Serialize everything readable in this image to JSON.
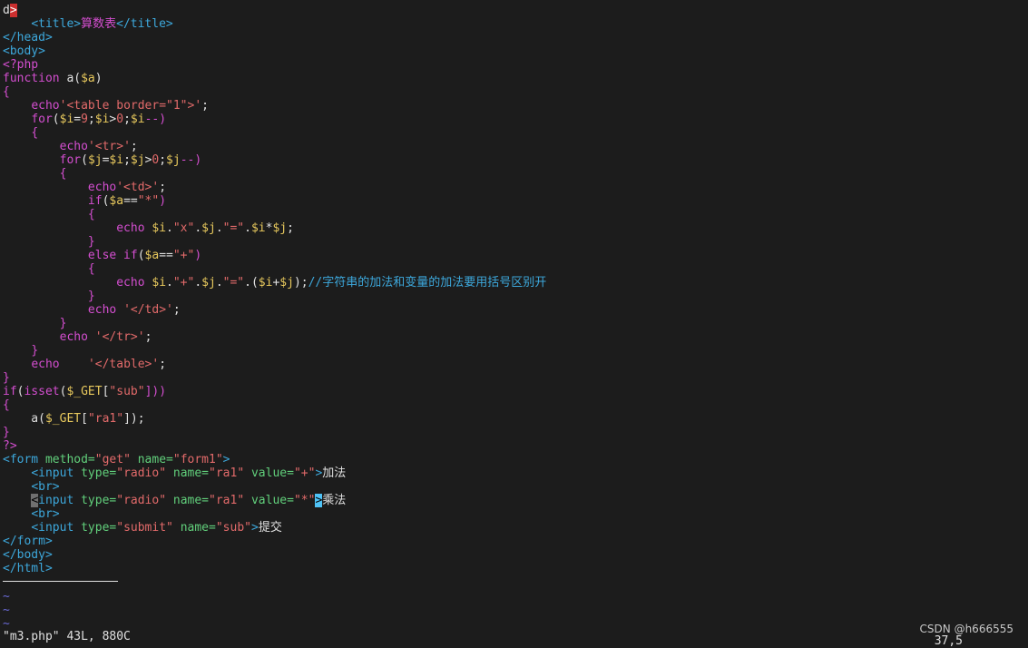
{
  "colors": {
    "background": "#1c1c1c",
    "text": "#e0e0e0",
    "keyword": "#d34ecf",
    "variable": "#e8c95d",
    "string": "#e26a6a",
    "tag": "#3da8dc",
    "attr": "#61cf7b",
    "comment": "#3da8dc",
    "tilde": "#6a6ad6"
  },
  "lines": [
    [
      {
        "t": "d",
        "c": "#e0e0e0"
      },
      {
        "t": ">",
        "c": "#ffffff",
        "cls": "cur"
      }
    ],
    [
      {
        "t": "    ",
        "c": "#e0e0e0"
      },
      {
        "t": "<title>",
        "c": "#3da8dc"
      },
      {
        "t": "算数表",
        "c": "#d34ecf"
      },
      {
        "t": "</title>",
        "c": "#3da8dc"
      }
    ],
    [
      {
        "t": "</head>",
        "c": "#3da8dc"
      }
    ],
    [
      {
        "t": "<body>",
        "c": "#3da8dc"
      }
    ],
    [
      {
        "t": "<?php",
        "c": "#d34ecf"
      }
    ],
    [
      {
        "t": "function",
        "c": "#d34ecf"
      },
      {
        "t": " a(",
        "c": "#e0e0e0"
      },
      {
        "t": "$a",
        "c": "#e8c95d"
      },
      {
        "t": ")",
        "c": "#e0e0e0"
      }
    ],
    [
      {
        "t": "{",
        "c": "#d34ecf"
      }
    ],
    [
      {
        "t": "    ",
        "c": "#e0e0e0"
      },
      {
        "t": "echo",
        "c": "#d34ecf"
      },
      {
        "t": "'<table border=\"1\">'",
        "c": "#e26a6a"
      },
      {
        "t": ";",
        "c": "#e0e0e0"
      }
    ],
    [
      {
        "t": "    ",
        "c": "#e0e0e0"
      },
      {
        "t": "for",
        "c": "#d34ecf"
      },
      {
        "t": "(",
        "c": "#e0e0e0"
      },
      {
        "t": "$i",
        "c": "#e8c95d"
      },
      {
        "t": "=",
        "c": "#e0e0e0"
      },
      {
        "t": "9",
        "c": "#e26a6a"
      },
      {
        "t": ";",
        "c": "#e0e0e0"
      },
      {
        "t": "$i",
        "c": "#e8c95d"
      },
      {
        "t": ">",
        "c": "#e0e0e0"
      },
      {
        "t": "0",
        "c": "#e26a6a"
      },
      {
        "t": ";",
        "c": "#e0e0e0"
      },
      {
        "t": "$i",
        "c": "#e8c95d"
      },
      {
        "t": "--)",
        "c": "#d34ecf"
      }
    ],
    [
      {
        "t": "    ",
        "c": "#e0e0e0"
      },
      {
        "t": "{",
        "c": "#d34ecf"
      }
    ],
    [
      {
        "t": "        ",
        "c": "#e0e0e0"
      },
      {
        "t": "echo",
        "c": "#d34ecf"
      },
      {
        "t": "'<tr>'",
        "c": "#e26a6a"
      },
      {
        "t": ";",
        "c": "#e0e0e0"
      }
    ],
    [
      {
        "t": "        ",
        "c": "#e0e0e0"
      },
      {
        "t": "for",
        "c": "#d34ecf"
      },
      {
        "t": "(",
        "c": "#e0e0e0"
      },
      {
        "t": "$j",
        "c": "#e8c95d"
      },
      {
        "t": "=",
        "c": "#e0e0e0"
      },
      {
        "t": "$i",
        "c": "#e8c95d"
      },
      {
        "t": ";",
        "c": "#e0e0e0"
      },
      {
        "t": "$j",
        "c": "#e8c95d"
      },
      {
        "t": ">",
        "c": "#e0e0e0"
      },
      {
        "t": "0",
        "c": "#e26a6a"
      },
      {
        "t": ";",
        "c": "#e0e0e0"
      },
      {
        "t": "$j",
        "c": "#e8c95d"
      },
      {
        "t": "--)",
        "c": "#d34ecf"
      }
    ],
    [
      {
        "t": "        ",
        "c": "#e0e0e0"
      },
      {
        "t": "{",
        "c": "#d34ecf"
      }
    ],
    [
      {
        "t": "            ",
        "c": "#e0e0e0"
      },
      {
        "t": "echo",
        "c": "#d34ecf"
      },
      {
        "t": "'<td>'",
        "c": "#e26a6a"
      },
      {
        "t": ";",
        "c": "#e0e0e0"
      }
    ],
    [
      {
        "t": "            ",
        "c": "#e0e0e0"
      },
      {
        "t": "if",
        "c": "#d34ecf"
      },
      {
        "t": "(",
        "c": "#e0e0e0"
      },
      {
        "t": "$a",
        "c": "#e8c95d"
      },
      {
        "t": "==",
        "c": "#e0e0e0"
      },
      {
        "t": "\"*\"",
        "c": "#e26a6a"
      },
      {
        "t": ")",
        "c": "#d34ecf"
      }
    ],
    [
      {
        "t": "            ",
        "c": "#e0e0e0"
      },
      {
        "t": "{",
        "c": "#d34ecf"
      }
    ],
    [
      {
        "t": "                ",
        "c": "#e0e0e0"
      },
      {
        "t": "echo",
        "c": "#d34ecf"
      },
      {
        "t": " ",
        "c": "#e0e0e0"
      },
      {
        "t": "$i",
        "c": "#e8c95d"
      },
      {
        "t": ".",
        "c": "#e0e0e0"
      },
      {
        "t": "\"x\"",
        "c": "#e26a6a"
      },
      {
        "t": ".",
        "c": "#e0e0e0"
      },
      {
        "t": "$j",
        "c": "#e8c95d"
      },
      {
        "t": ".",
        "c": "#e0e0e0"
      },
      {
        "t": "\"=\"",
        "c": "#e26a6a"
      },
      {
        "t": ".",
        "c": "#e0e0e0"
      },
      {
        "t": "$i",
        "c": "#e8c95d"
      },
      {
        "t": "*",
        "c": "#e0e0e0"
      },
      {
        "t": "$j",
        "c": "#e8c95d"
      },
      {
        "t": ";",
        "c": "#e0e0e0"
      }
    ],
    [
      {
        "t": "            ",
        "c": "#e0e0e0"
      },
      {
        "t": "}",
        "c": "#d34ecf"
      }
    ],
    [
      {
        "t": "            ",
        "c": "#e0e0e0"
      },
      {
        "t": "else if",
        "c": "#d34ecf"
      },
      {
        "t": "(",
        "c": "#e0e0e0"
      },
      {
        "t": "$a",
        "c": "#e8c95d"
      },
      {
        "t": "==",
        "c": "#e0e0e0"
      },
      {
        "t": "\"+\"",
        "c": "#e26a6a"
      },
      {
        "t": ")",
        "c": "#d34ecf"
      }
    ],
    [
      {
        "t": "            ",
        "c": "#e0e0e0"
      },
      {
        "t": "{",
        "c": "#d34ecf"
      }
    ],
    [
      {
        "t": "                ",
        "c": "#e0e0e0"
      },
      {
        "t": "echo",
        "c": "#d34ecf"
      },
      {
        "t": " ",
        "c": "#e0e0e0"
      },
      {
        "t": "$i",
        "c": "#e8c95d"
      },
      {
        "t": ".",
        "c": "#e0e0e0"
      },
      {
        "t": "\"+\"",
        "c": "#e26a6a"
      },
      {
        "t": ".",
        "c": "#e0e0e0"
      },
      {
        "t": "$j",
        "c": "#e8c95d"
      },
      {
        "t": ".",
        "c": "#e0e0e0"
      },
      {
        "t": "\"=\"",
        "c": "#e26a6a"
      },
      {
        "t": ".(",
        "c": "#e0e0e0"
      },
      {
        "t": "$i",
        "c": "#e8c95d"
      },
      {
        "t": "+",
        "c": "#e0e0e0"
      },
      {
        "t": "$j",
        "c": "#e8c95d"
      },
      {
        "t": ");",
        "c": "#e0e0e0"
      },
      {
        "t": "//字符串的加法和变量的加法要用括号区别开",
        "c": "#3da8dc"
      }
    ],
    [
      {
        "t": "            ",
        "c": "#e0e0e0"
      },
      {
        "t": "}",
        "c": "#d34ecf"
      }
    ],
    [
      {
        "t": "            ",
        "c": "#e0e0e0"
      },
      {
        "t": "echo",
        "c": "#d34ecf"
      },
      {
        "t": " ",
        "c": "#e0e0e0"
      },
      {
        "t": "'</td>'",
        "c": "#e26a6a"
      },
      {
        "t": ";",
        "c": "#e0e0e0"
      }
    ],
    [
      {
        "t": "        ",
        "c": "#e0e0e0"
      },
      {
        "t": "}",
        "c": "#d34ecf"
      }
    ],
    [
      {
        "t": "        ",
        "c": "#e0e0e0"
      },
      {
        "t": "echo",
        "c": "#d34ecf"
      },
      {
        "t": " ",
        "c": "#e0e0e0"
      },
      {
        "t": "'</tr>'",
        "c": "#e26a6a"
      },
      {
        "t": ";",
        "c": "#e0e0e0"
      }
    ],
    [
      {
        "t": "    ",
        "c": "#e0e0e0"
      },
      {
        "t": "}",
        "c": "#d34ecf"
      }
    ],
    [
      {
        "t": "    ",
        "c": "#e0e0e0"
      },
      {
        "t": "echo",
        "c": "#d34ecf"
      },
      {
        "t": "    ",
        "c": "#e0e0e0"
      },
      {
        "t": "'</table>'",
        "c": "#e26a6a"
      },
      {
        "t": ";",
        "c": "#e0e0e0"
      }
    ],
    [
      {
        "t": "}",
        "c": "#d34ecf"
      }
    ],
    [
      {
        "t": "if",
        "c": "#d34ecf"
      },
      {
        "t": "(",
        "c": "#e0e0e0"
      },
      {
        "t": "isset",
        "c": "#d34ecf"
      },
      {
        "t": "(",
        "c": "#e0e0e0"
      },
      {
        "t": "$_GET",
        "c": "#e8c95d"
      },
      {
        "t": "[",
        "c": "#e0e0e0"
      },
      {
        "t": "\"sub\"",
        "c": "#e26a6a"
      },
      {
        "t": "]))",
        "c": "#d34ecf"
      }
    ],
    [
      {
        "t": "{",
        "c": "#d34ecf"
      }
    ],
    [
      {
        "t": "    a(",
        "c": "#e0e0e0"
      },
      {
        "t": "$_GET",
        "c": "#e8c95d"
      },
      {
        "t": "[",
        "c": "#e0e0e0"
      },
      {
        "t": "\"ra1\"",
        "c": "#e26a6a"
      },
      {
        "t": "]);",
        "c": "#e0e0e0"
      }
    ],
    [
      {
        "t": "}",
        "c": "#d34ecf"
      }
    ],
    [
      {
        "t": "?>",
        "c": "#d34ecf"
      }
    ],
    [
      {
        "t": "<form",
        "c": "#3da8dc"
      },
      {
        "t": " method=",
        "c": "#61cf7b"
      },
      {
        "t": "\"get\"",
        "c": "#e26a6a"
      },
      {
        "t": " name=",
        "c": "#61cf7b"
      },
      {
        "t": "\"form1\"",
        "c": "#e26a6a"
      },
      {
        "t": ">",
        "c": "#3da8dc"
      }
    ],
    [
      {
        "t": "    ",
        "c": "#e0e0e0"
      },
      {
        "t": "<input",
        "c": "#3da8dc"
      },
      {
        "t": " type=",
        "c": "#61cf7b"
      },
      {
        "t": "\"radio\"",
        "c": "#e26a6a"
      },
      {
        "t": " name=",
        "c": "#61cf7b"
      },
      {
        "t": "\"ra1\"",
        "c": "#e26a6a"
      },
      {
        "t": " value=",
        "c": "#61cf7b"
      },
      {
        "t": "\"+\"",
        "c": "#e26a6a"
      },
      {
        "t": ">",
        "c": "#3da8dc"
      },
      {
        "t": "加法",
        "c": "#e0e0e0"
      }
    ],
    [
      {
        "t": "    ",
        "c": "#e0e0e0"
      },
      {
        "t": "<br>",
        "c": "#3da8dc"
      }
    ],
    [
      {
        "t": "    ",
        "c": "#e0e0e0"
      },
      {
        "t": "<",
        "c": "#000000",
        "cls": "curgray"
      },
      {
        "t": "input",
        "c": "#3da8dc"
      },
      {
        "t": " type=",
        "c": "#61cf7b"
      },
      {
        "t": "\"radio\"",
        "c": "#e26a6a"
      },
      {
        "t": " name=",
        "c": "#61cf7b"
      },
      {
        "t": "\"ra1\"",
        "c": "#e26a6a"
      },
      {
        "t": " value=",
        "c": "#61cf7b"
      },
      {
        "t": "\"*\"",
        "c": "#e26a6a"
      },
      {
        "t": ">",
        "c": "#000000",
        "cls": "curblk"
      },
      {
        "t": "乘法",
        "c": "#e0e0e0"
      }
    ],
    [
      {
        "t": "    ",
        "c": "#e0e0e0"
      },
      {
        "t": "<br>",
        "c": "#3da8dc"
      }
    ],
    [
      {
        "t": "    ",
        "c": "#e0e0e0"
      },
      {
        "t": "<input",
        "c": "#3da8dc"
      },
      {
        "t": " type=",
        "c": "#61cf7b"
      },
      {
        "t": "\"submit\"",
        "c": "#e26a6a"
      },
      {
        "t": " name=",
        "c": "#61cf7b"
      },
      {
        "t": "\"sub\"",
        "c": "#e26a6a"
      },
      {
        "t": ">",
        "c": "#3da8dc"
      },
      {
        "t": "提交",
        "c": "#e0e0e0"
      }
    ],
    [
      {
        "t": "</form>",
        "c": "#3da8dc"
      }
    ],
    [
      {
        "t": "</body>",
        "c": "#3da8dc"
      }
    ],
    [
      {
        "t": "</html>",
        "c": "#3da8dc"
      }
    ]
  ],
  "tildes": [
    "~",
    "~",
    "~"
  ],
  "status": {
    "file_info": "\"m3.php\" 43L, 880C",
    "cursor_position": "37,5"
  },
  "watermark": "CSDN @h666555"
}
